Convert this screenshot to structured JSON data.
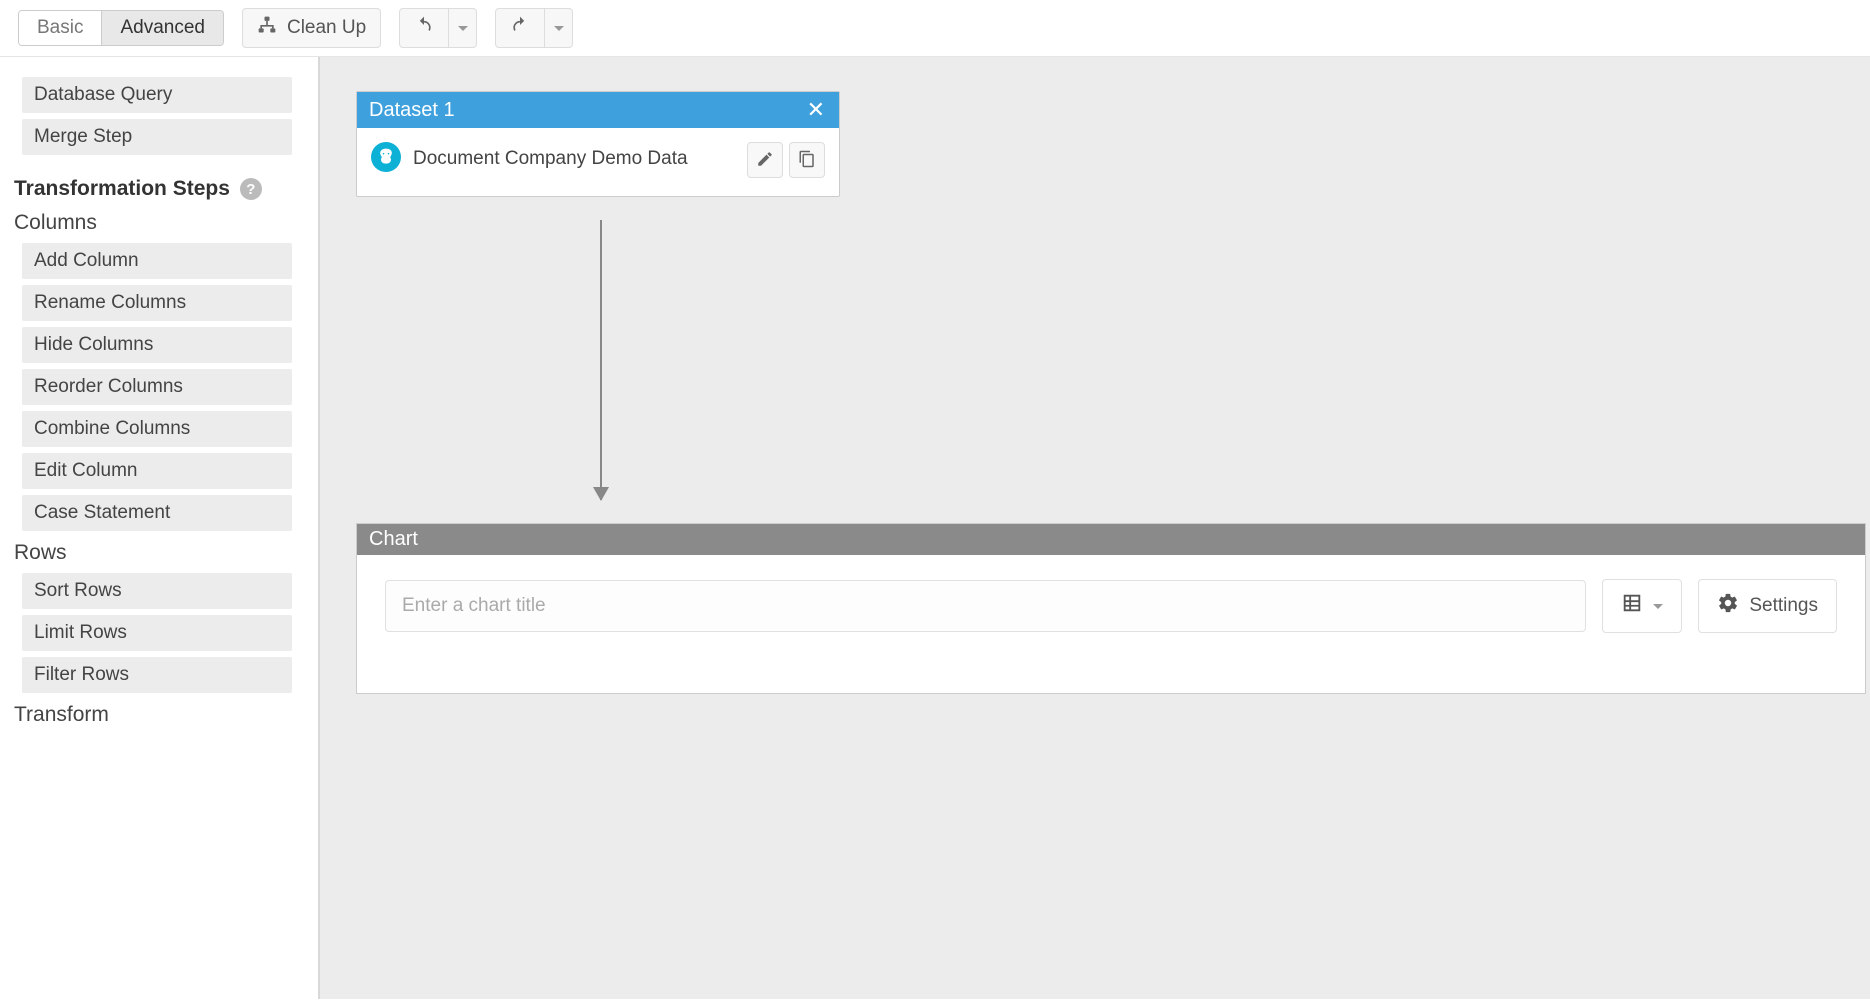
{
  "toolbar": {
    "mode_basic": "Basic",
    "mode_advanced": "Advanced",
    "cleanup": "Clean Up"
  },
  "sidebar": {
    "top_items": [
      "Database Query",
      "Merge Step"
    ],
    "transformation_header": "Transformation Steps",
    "groups": [
      {
        "title": "Columns",
        "items": [
          "Add Column",
          "Rename Columns",
          "Hide Columns",
          "Reorder Columns",
          "Combine Columns",
          "Edit Column",
          "Case Statement"
        ]
      },
      {
        "title": "Rows",
        "items": [
          "Sort Rows",
          "Limit Rows",
          "Filter Rows"
        ]
      },
      {
        "title": "Transform",
        "items": []
      }
    ]
  },
  "canvas": {
    "dataset": {
      "heading": "Dataset 1",
      "source_label": "Document Company Demo Data"
    },
    "chart": {
      "heading": "Chart",
      "title_placeholder": "Enter a chart title",
      "settings_label": "Settings"
    }
  }
}
